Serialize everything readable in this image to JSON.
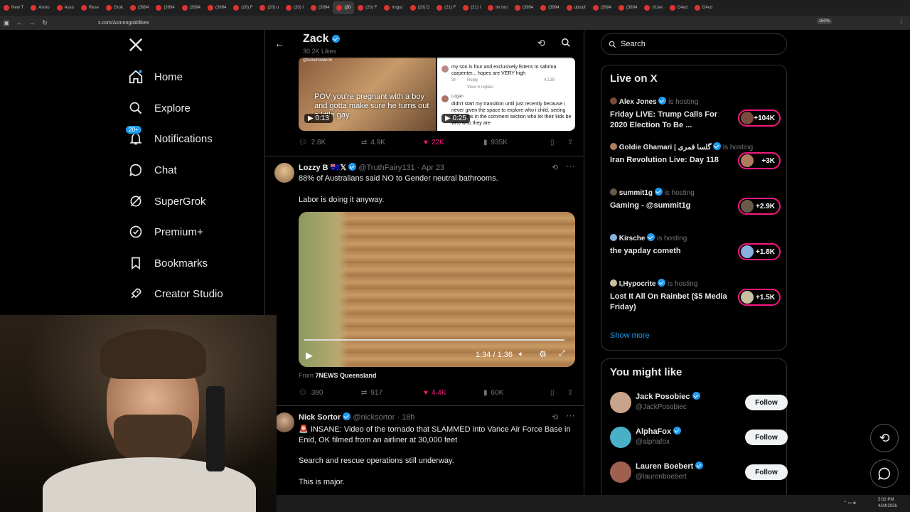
{
  "browser": {
    "tabs": [
      "New T",
      "Asmo",
      "Asso",
      "Rese",
      "Grok",
      "(3994",
      "(3994",
      "(3994",
      "(3994",
      "(20) F",
      "(20) u",
      "(20) I",
      "(3994",
      "(20",
      "(20) F",
      "Imgur",
      "(20) D",
      "(21) F",
      "(21) I",
      "im bro",
      "(3994",
      "(3994",
      "ubisof",
      "(3994",
      "(3994",
      "r/Live",
      "D4vd",
      "D4vd"
    ],
    "active_tab": "(20",
    "url": "x.com/Asmongold/likes",
    "zoom": "150%"
  },
  "nav": {
    "items": [
      {
        "label": "Home",
        "icon": "home-icon"
      },
      {
        "label": "Explore",
        "icon": "search-icon"
      },
      {
        "label": "Notifications",
        "icon": "bell-icon",
        "badge": "20+"
      },
      {
        "label": "Chat",
        "icon": "chat-icon"
      },
      {
        "label": "SuperGrok",
        "icon": "grok-icon"
      },
      {
        "label": "Premium+",
        "icon": "premium-icon"
      },
      {
        "label": "Bookmarks",
        "icon": "bookmark-icon"
      },
      {
        "label": "Creator Studio",
        "icon": "rocket-icon"
      }
    ]
  },
  "header": {
    "name": "Zack",
    "likes": "30.2K Likes"
  },
  "tweet1": {
    "media1_caption": "POV you're pregnant with a boy and gotta make sure he turns out a little gay",
    "media1_duration": "0:13",
    "media1_handle": "@katiehowle06",
    "media2_comment1": "my son is four and exclusively listens to sabrina carpenter... hopes are VERY high",
    "media2_time": "3h",
    "media2_reply": "Reply",
    "media2_likes": "4,139",
    "media2_view": "View 6 replies",
    "media2_user": "Logan",
    "media2_comment2": "didn't start my transition until just recently because i never given the space to explore who i child. seeing the moms in the comment section who let their kids be who who they are",
    "media2_duration": "0:25",
    "replies": "2.8K",
    "reposts": "4.9K",
    "likes": "22K",
    "views": "935K"
  },
  "tweet2": {
    "name": "Lozzy B",
    "handle": "@TruthFairy131",
    "date": "Apr 23",
    "text1": "88% of Australians said NO to Gender neutral bathrooms.",
    "text2": "Labor is doing it anyway.",
    "time": "1:34 / 1:36",
    "from_prefix": "From",
    "from": "7NEWS Queensland",
    "replies": "380",
    "reposts": "917",
    "likes": "4.4K",
    "views": "60K"
  },
  "tweet3": {
    "name": "Nick Sortor",
    "handle": "@nicksortor",
    "date": "18h",
    "text1": "INSANE: Video of the tornado that SLAMMED into Vance Air Force Base in Enid, OK filmed from an airliner at 30,000 feet",
    "text2": "Search and rescue operations still underway.",
    "text3": "This is major."
  },
  "search": {
    "placeholder": "Search"
  },
  "live": {
    "title": "Live on X",
    "hosting_label": "is hosting",
    "hosts": [
      {
        "name": "Alex Jones",
        "title": "Friday LIVE: Trump Calls For 2020 Election To Be ...",
        "count": "+104K",
        "color": "#7a4a3a"
      },
      {
        "name": "Goldie Ghamari | گلسا قمری",
        "title": "Iran Revolution Live: Day 118",
        "count": "+3K",
        "color": "#b07a60"
      },
      {
        "name": "summit1g",
        "title": "Gaming - @summit1g",
        "count": "+2.9K",
        "color": "#6a5a4a"
      },
      {
        "name": "Kirsche",
        "title": "the yapday cometh",
        "count": "+1.8K",
        "color": "#8ab0e0"
      },
      {
        "name": "I,Hypocrite",
        "title": "Lost It All On Rainbet ($5 Media Friday)",
        "count": "+1.5K",
        "color": "#c8c0a0"
      }
    ],
    "show_more": "Show more"
  },
  "suggest": {
    "title": "You might like",
    "follow_label": "Follow",
    "users": [
      {
        "name": "Jack Posobiec",
        "handle": "@JackPosobiec",
        "color": "#c9a38a"
      },
      {
        "name": "AlphaFox",
        "handle": "@alphafox",
        "color": "#4ab0c8"
      },
      {
        "name": "Lauren Boebert",
        "handle": "@laurenboebert",
        "color": "#a06050"
      }
    ]
  },
  "taskbar": {
    "time": "5:02 PM",
    "date": "4/24/2026"
  },
  "colors": {
    "accent": "#1d9bf0",
    "like": "#f91880",
    "bg": "#000000",
    "border": "#2f3336"
  }
}
